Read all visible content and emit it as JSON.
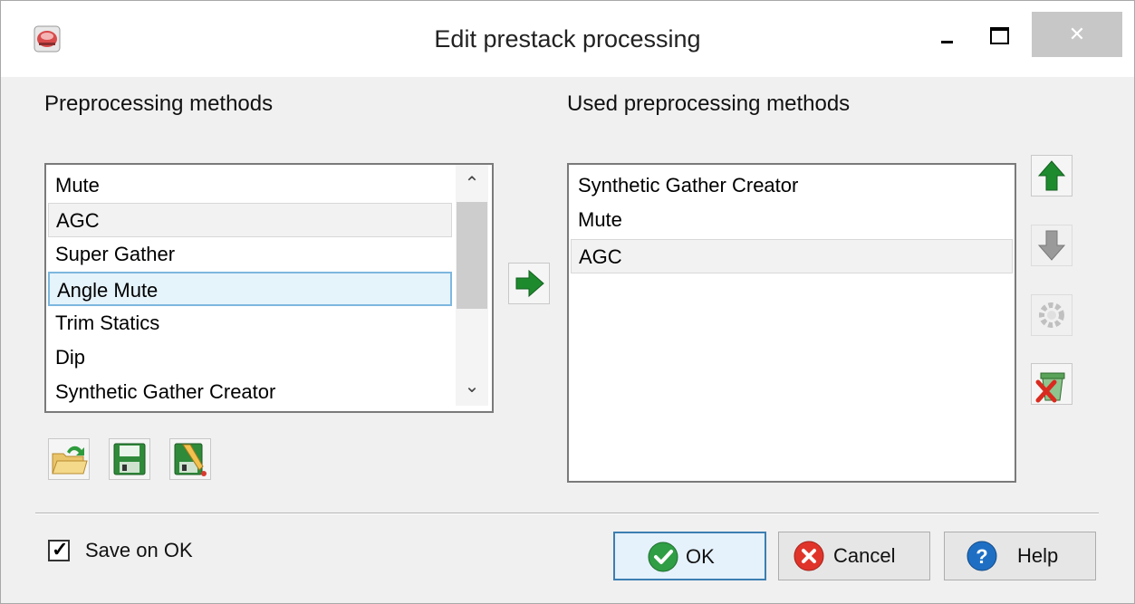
{
  "window": {
    "title": "Edit prestack processing",
    "close_glyph": "✕"
  },
  "left": {
    "label": "Preprocessing methods",
    "items": [
      "Mute",
      "AGC",
      "Super Gather",
      "Angle Mute",
      "Trim Statics",
      "Dip",
      "Synthetic Gather Creator"
    ],
    "scroll_up_glyph": "⌃",
    "scroll_down_glyph": "⌄"
  },
  "right": {
    "label": "Used preprocessing methods",
    "items": [
      "Synthetic Gather Creator",
      "Mute",
      "AGC"
    ]
  },
  "toolbar_icons": [
    "open-folder-icon",
    "save-disk-icon",
    "edit-disk-icon",
    "arrow-right-icon",
    "arrow-up-icon",
    "arrow-down-icon",
    "settings-gear-icon",
    "delete-trash-icon"
  ],
  "footer": {
    "save_on_ok_label": "Save on OK",
    "save_on_ok_checked": true,
    "ok_label": "OK",
    "cancel_label": "Cancel",
    "help_label": "Help"
  },
  "colors": {
    "selection_fill": "#e5f3fb",
    "selection_border": "#7db7df",
    "default_button_border": "#3c7fb1",
    "arrow_green": "#1e8a2e",
    "ok_green": "#2f9e44",
    "cancel_red": "#e0342a",
    "help_blue": "#1e6fc4"
  }
}
